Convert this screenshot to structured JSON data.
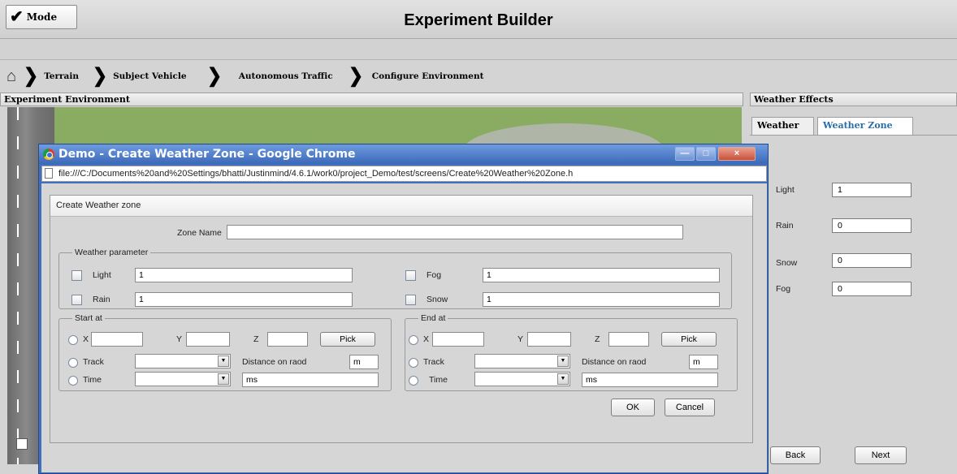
{
  "app": {
    "title": "Experiment Builder",
    "mode_label": "Mode"
  },
  "breadcrumbs": [
    {
      "label": "Terrain"
    },
    {
      "label": "Subject Vehicle"
    },
    {
      "label": "Autonomous Traffic"
    },
    {
      "label": "Configure Environment"
    }
  ],
  "env_panel": {
    "header": "Experiment Environment"
  },
  "weather_panel": {
    "header": "Weather Effects",
    "tabs": [
      {
        "label": "Weather",
        "active": false
      },
      {
        "label": "Weather Zone",
        "active": true
      }
    ],
    "fields": [
      {
        "label": "Light",
        "value": "1"
      },
      {
        "label": "Rain",
        "value": "0"
      },
      {
        "label": "Snow",
        "value": "0"
      },
      {
        "label": "Fog",
        "value": "0"
      }
    ],
    "back_label": "Back",
    "next_label": "Next"
  },
  "dialog": {
    "window_title": "Demo - Create Weather Zone - Google Chrome",
    "url": "file:///C:/Documents%20and%20Settings/bhatti/Justinmind/4.6.1/work0/project_Demo/test/screens/Create%20Weather%20Zone.h",
    "window_buttons": [
      "—",
      "□",
      "×"
    ],
    "form_title": "Create Weather zone",
    "zone_name_label": "Zone Name",
    "zone_name_value": "",
    "weather_group": "Weather parameter",
    "weather_fields": {
      "light": {
        "label": "Light",
        "value": "1"
      },
      "fog": {
        "label": "Fog",
        "value": "1"
      },
      "rain": {
        "label": "Rain",
        "value": "1"
      },
      "snow": {
        "label": "Snow",
        "value": "1"
      }
    },
    "start": {
      "group": "Start at",
      "x_label": "X",
      "y_label": "Y",
      "z_label": "Z",
      "pick_label": "Pick",
      "track_label": "Track",
      "distance_label": "Distance on raod",
      "distance_value": "m",
      "time_label": "Time",
      "time_value": "ms"
    },
    "end": {
      "group": "End at",
      "x_label": "X",
      "y_label": "Y",
      "z_label": "Z",
      "pick_label": "Pick",
      "track_label": "Track",
      "distance_label": "Distance on raod",
      "distance_value": "m",
      "time_label": "Time",
      "time_value": "ms"
    },
    "ok_label": "OK",
    "cancel_label": "Cancel"
  }
}
